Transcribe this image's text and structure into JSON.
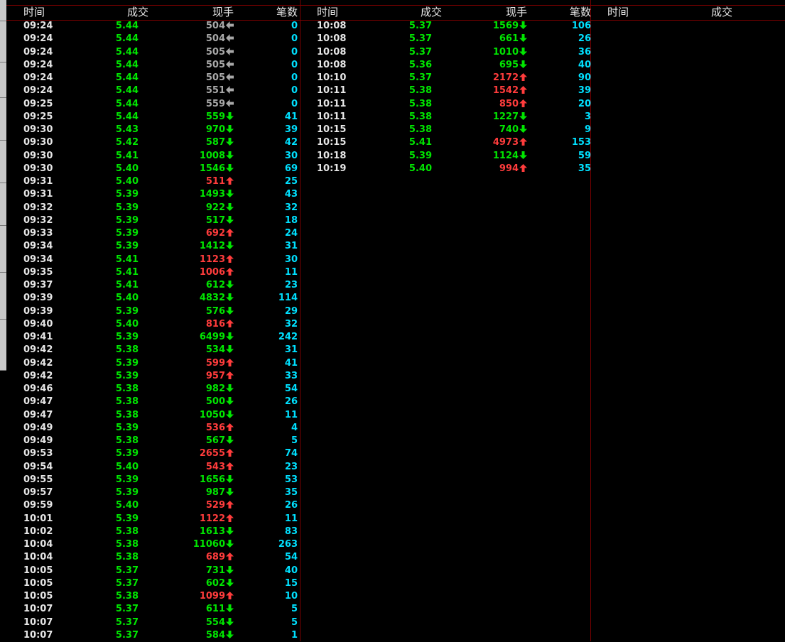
{
  "headers": {
    "time": "时间",
    "price": "成交",
    "volume": "现手",
    "count": "笔数"
  },
  "colors": {
    "background": "#000000",
    "grid": "#7a0000",
    "time": "#e6e6e6",
    "price": "#00e600",
    "up": "#ff3c3c",
    "down": "#00e600",
    "flat": "#a8a8a8",
    "count": "#00e0ff"
  },
  "panels": [
    {
      "rows": [
        [
          "09:24",
          "5.44",
          "504",
          "flat",
          "0"
        ],
        [
          "09:24",
          "5.44",
          "504",
          "flat",
          "0"
        ],
        [
          "09:24",
          "5.44",
          "505",
          "flat",
          "0"
        ],
        [
          "09:24",
          "5.44",
          "505",
          "flat",
          "0"
        ],
        [
          "09:24",
          "5.44",
          "505",
          "flat",
          "0"
        ],
        [
          "09:24",
          "5.44",
          "551",
          "flat",
          "0"
        ],
        [
          "09:25",
          "5.44",
          "559",
          "flat",
          "0"
        ],
        [
          "09:25",
          "5.44",
          "559",
          "down",
          "41"
        ],
        [
          "09:30",
          "5.43",
          "970",
          "down",
          "39"
        ],
        [
          "09:30",
          "5.42",
          "587",
          "down",
          "42"
        ],
        [
          "09:30",
          "5.41",
          "1008",
          "down",
          "30"
        ],
        [
          "09:30",
          "5.40",
          "1546",
          "down",
          "69"
        ],
        [
          "09:31",
          "5.40",
          "511",
          "up",
          "25"
        ],
        [
          "09:31",
          "5.39",
          "1493",
          "down",
          "43"
        ],
        [
          "09:32",
          "5.39",
          "922",
          "down",
          "32"
        ],
        [
          "09:32",
          "5.39",
          "517",
          "down",
          "18"
        ],
        [
          "09:33",
          "5.39",
          "692",
          "up",
          "24"
        ],
        [
          "09:34",
          "5.39",
          "1412",
          "down",
          "31"
        ],
        [
          "09:34",
          "5.41",
          "1123",
          "up",
          "30"
        ],
        [
          "09:35",
          "5.41",
          "1006",
          "up",
          "11"
        ],
        [
          "09:37",
          "5.41",
          "612",
          "down",
          "23"
        ],
        [
          "09:39",
          "5.40",
          "4832",
          "down",
          "114"
        ],
        [
          "09:39",
          "5.39",
          "576",
          "down",
          "29"
        ],
        [
          "09:40",
          "5.40",
          "816",
          "up",
          "32"
        ],
        [
          "09:41",
          "5.39",
          "6499",
          "down",
          "242"
        ],
        [
          "09:42",
          "5.38",
          "534",
          "down",
          "31"
        ],
        [
          "09:42",
          "5.39",
          "599",
          "up",
          "41"
        ],
        [
          "09:42",
          "5.39",
          "957",
          "up",
          "33"
        ],
        [
          "09:46",
          "5.38",
          "982",
          "down",
          "54"
        ],
        [
          "09:47",
          "5.38",
          "500",
          "down",
          "26"
        ],
        [
          "09:47",
          "5.38",
          "1050",
          "down",
          "11"
        ],
        [
          "09:49",
          "5.39",
          "536",
          "up",
          "4"
        ],
        [
          "09:49",
          "5.38",
          "567",
          "down",
          "5"
        ],
        [
          "09:53",
          "5.39",
          "2655",
          "up",
          "74"
        ],
        [
          "09:54",
          "5.40",
          "543",
          "up",
          "23"
        ],
        [
          "09:55",
          "5.39",
          "1656",
          "down",
          "53"
        ],
        [
          "09:57",
          "5.39",
          "987",
          "down",
          "35"
        ],
        [
          "09:59",
          "5.40",
          "529",
          "up",
          "26"
        ],
        [
          "10:01",
          "5.39",
          "1122",
          "up",
          "11"
        ],
        [
          "10:02",
          "5.38",
          "1613",
          "down",
          "83"
        ],
        [
          "10:04",
          "5.38",
          "11060",
          "down",
          "263"
        ],
        [
          "10:04",
          "5.38",
          "689",
          "up",
          "54"
        ],
        [
          "10:05",
          "5.37",
          "731",
          "down",
          "40"
        ],
        [
          "10:05",
          "5.37",
          "602",
          "down",
          "15"
        ],
        [
          "10:05",
          "5.38",
          "1099",
          "up",
          "10"
        ],
        [
          "10:07",
          "5.37",
          "611",
          "down",
          "5"
        ],
        [
          "10:07",
          "5.37",
          "554",
          "down",
          "5"
        ],
        [
          "10:07",
          "5.37",
          "584",
          "down",
          "1"
        ]
      ]
    },
    {
      "rows": [
        [
          "10:08",
          "5.37",
          "1569",
          "down",
          "106"
        ],
        [
          "10:08",
          "5.37",
          "661",
          "down",
          "26"
        ],
        [
          "10:08",
          "5.37",
          "1010",
          "down",
          "36"
        ],
        [
          "10:08",
          "5.36",
          "695",
          "down",
          "40"
        ],
        [
          "10:10",
          "5.37",
          "2172",
          "up",
          "90"
        ],
        [
          "10:11",
          "5.38",
          "1542",
          "up",
          "39"
        ],
        [
          "10:11",
          "5.38",
          "850",
          "up",
          "20"
        ],
        [
          "10:11",
          "5.38",
          "1227",
          "down",
          "3"
        ],
        [
          "10:15",
          "5.38",
          "740",
          "down",
          "9"
        ],
        [
          "10:15",
          "5.41",
          "4973",
          "up",
          "153"
        ],
        [
          "10:18",
          "5.39",
          "1124",
          "down",
          "59"
        ],
        [
          "10:19",
          "5.40",
          "994",
          "up",
          "35"
        ]
      ]
    },
    {
      "rows": []
    }
  ]
}
